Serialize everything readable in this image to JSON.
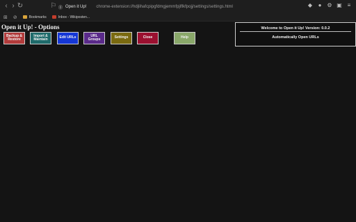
{
  "browser": {
    "tab_title": "Open it Up!",
    "url": "chrome-extension://hdjlihafcpipgfdmgjemmfpjlflkfpojj/settings/settings.html",
    "bookmarks": [
      {
        "label": "Bookmarks",
        "icon": "folder-icon"
      },
      {
        "label": "Inbox - Wikiposten...",
        "icon": "mail-icon"
      }
    ]
  },
  "page": {
    "title": "Open it Up! - Options"
  },
  "toolbar": {
    "buttons": [
      {
        "label": "Backup &\nRestore",
        "color": "#b23b3b"
      },
      {
        "label": "Import &\nMaintain",
        "color": "#1f6b6b"
      },
      {
        "label": "Edit URLs",
        "color": "#1537d6"
      },
      {
        "label": "URL\nGroups",
        "color": "#5a2a8a"
      },
      {
        "label": "Settings",
        "color": "#7a6a10"
      },
      {
        "label": "Close",
        "color": "#9b1030"
      },
      {
        "label": "Help",
        "color": "#8aa86a"
      }
    ]
  },
  "status": {
    "welcome": "Welcome to Open it Up! Version: 0.0.2",
    "mode": "Automatically Open URLs"
  }
}
